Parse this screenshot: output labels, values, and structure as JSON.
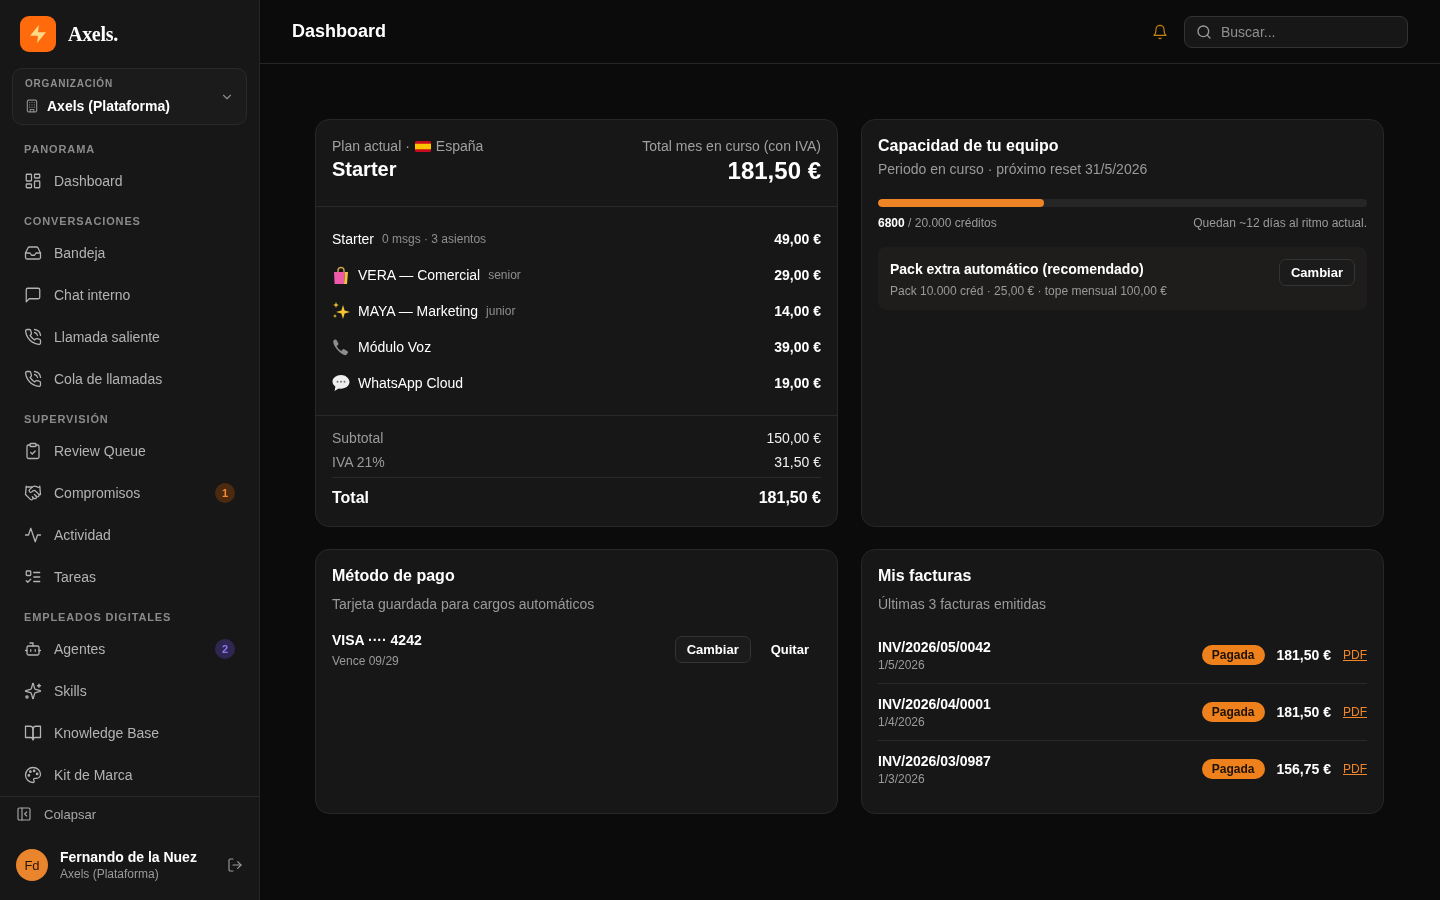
{
  "sidebar": {
    "brand": "Axels.",
    "organization": {
      "label": "ORGANIZACIÓN",
      "name": "Axels (Plataforma)"
    },
    "sections": [
      {
        "title": "PANORAMA",
        "items": [
          {
            "label": "Dashboard"
          }
        ]
      },
      {
        "title": "CONVERSACIONES",
        "items": [
          {
            "label": "Bandeja"
          },
          {
            "label": "Chat interno"
          },
          {
            "label": "Llamada saliente"
          },
          {
            "label": "Cola de llamadas"
          }
        ]
      },
      {
        "title": "SUPERVISIÓN",
        "items": [
          {
            "label": "Review Queue"
          },
          {
            "label": "Compromisos",
            "badge": "1",
            "color": "#4b2a10"
          },
          {
            "label": "Actividad"
          },
          {
            "label": "Tareas"
          }
        ]
      },
      {
        "title": "EMPLEADOS DIGITALES",
        "items": [
          {
            "label": "Agentes",
            "badge": "2",
            "color": "#2f2752"
          },
          {
            "label": "Skills"
          },
          {
            "label": "Knowledge Base"
          },
          {
            "label": "Kit de Marca"
          }
        ]
      }
    ],
    "collapse": "Colapsar",
    "user": {
      "initials": "Fd",
      "name": "Fernando de la Nuez",
      "organization": "Axels (Plataforma)"
    }
  },
  "header": {
    "title": "Dashboard",
    "search": {
      "placeholder": "Buscar..."
    }
  },
  "plan": {
    "label": "Plan actual ·",
    "country": "España",
    "name": "Starter",
    "total_label": "Total mes en curso (con IVA)",
    "total": "181,50 €",
    "lines": [
      {
        "name": "Starter",
        "detail": "0 msgs · 3 asientos",
        "amount": "49,00 €"
      },
      {
        "name": "VERA — Comercial",
        "detail": "senior",
        "amount": "29,00 €"
      },
      {
        "name": "MAYA — Marketing",
        "detail": "junior",
        "amount": "14,00 €"
      },
      {
        "name": "Módulo Voz",
        "amount": "39,00 €"
      },
      {
        "name": "WhatsApp Cloud",
        "amount": "19,00 €"
      }
    ],
    "subtotal": {
      "label": "Subtotal",
      "value": "150,00 €"
    },
    "tax": {
      "label": "IVA 21%",
      "value": "31,50 €"
    },
    "grand_total": {
      "label": "Total",
      "value": "181,50 €"
    }
  },
  "capacity": {
    "title": "Capacidad de tu equipo",
    "subtitle": "Periodo en curso · próximo reset 31/5/2026",
    "level": 0.34,
    "usage": "**6800** / 20.000 créditos",
    "forecast": "Quedan ~12 días al ritmo actual.",
    "pack": {
      "title": "Pack extra automático (recomendado)",
      "detail": "Pack 10.000 créd · 25,00 € · tope mensual 100,00 €",
      "button": "Cambiar"
    }
  },
  "payment": {
    "title": "Método de pago",
    "subtitle": "Tarjeta guardada para cargos automáticos",
    "card": "VISA ···· 4242",
    "expiry": "Vence 09/29",
    "buttons": [
      {
        "label": "Cambiar",
        "kind": "outline"
      },
      {
        "label": "Quitar",
        "kind": "ghost"
      }
    ]
  },
  "invoices": {
    "title": "Mis facturas",
    "subtitle": "Últimas 3 facturas emitidas",
    "rows": [
      {
        "number": "INV/2026/05/0042",
        "date": "1/5/2026",
        "status": "Pagada",
        "amount": "181,50 €",
        "link": "PDF"
      },
      {
        "number": "INV/2026/04/0001",
        "date": "1/4/2026",
        "status": "Pagada",
        "amount": "181,50 €",
        "link": "PDF"
      },
      {
        "number": "INV/2026/03/0987",
        "date": "1/3/2026",
        "status": "Pagada",
        "amount": "156,75 €",
        "link": "PDF"
      }
    ]
  }
}
